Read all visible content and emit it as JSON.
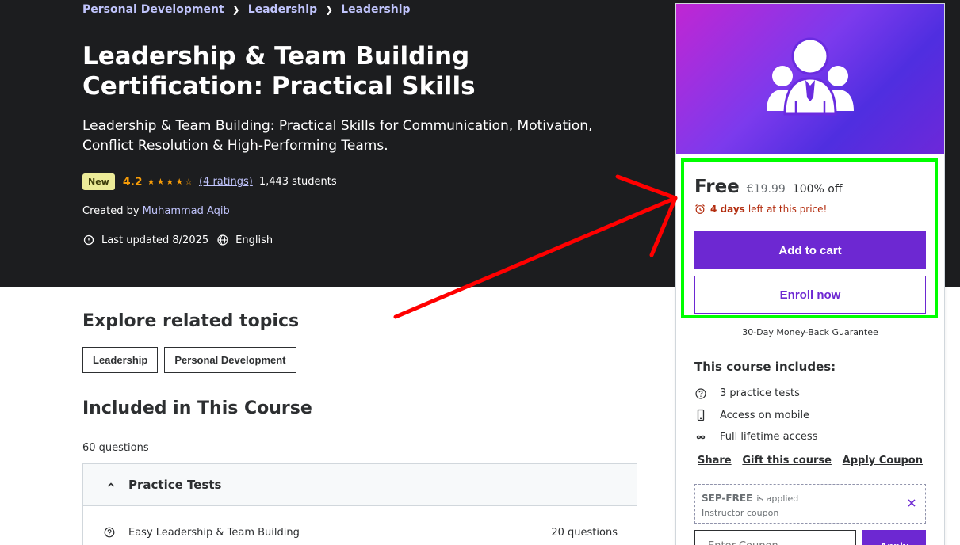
{
  "breadcrumb": [
    "Personal Development",
    "Leadership",
    "Leadership"
  ],
  "course": {
    "title": "Leadership & Team Building Certification: Practical Skills",
    "subtitle": "Leadership & Team Building: Practical Skills for Communication, Motivation, Conflict Resolution & High-Performing Teams.",
    "badge": "New",
    "rating": "4.2",
    "rating_value": 4.2,
    "ratings_link": "(4 ratings)",
    "students": "1,443 students",
    "created_by_label": "Created by",
    "instructor": "Muhammad Aqib",
    "last_updated": "Last updated 8/2025",
    "language": "English"
  },
  "related": {
    "heading": "Explore related topics",
    "topics": [
      "Leadership",
      "Personal Development"
    ]
  },
  "included": {
    "heading": "Included in This Course",
    "count": "60 questions",
    "section": "Practice Tests",
    "items": [
      {
        "name": "Easy Leadership & Team Building",
        "count": "20 questions"
      }
    ]
  },
  "sidebar": {
    "price": "Free",
    "original_price": "€19.99",
    "discount": "100% off",
    "timer_bold": "4 days",
    "timer_rest": "left at this price!",
    "add_to_cart": "Add to cart",
    "enroll_now": "Enroll now",
    "guarantee": "30-Day Money-Back Guarantee",
    "includes_title": "This course includes:",
    "includes": [
      {
        "icon": "question-circle-icon",
        "label": "3 practice tests"
      },
      {
        "icon": "mobile-icon",
        "label": "Access on mobile"
      },
      {
        "icon": "infinity-icon",
        "label": "Full lifetime access"
      }
    ],
    "links": [
      "Share",
      "Gift this course",
      "Apply Coupon"
    ],
    "coupon_code": "SEP-FREE",
    "coupon_applied": "is applied",
    "coupon_sub": "Instructor coupon",
    "coupon_placeholder": "Enter Coupon",
    "apply": "Apply"
  },
  "colors": {
    "hero_bg": "#1c1d1f",
    "accent_purple": "#6d28d2",
    "star": "#f69c08",
    "highlight_green": "#00ff00",
    "arrow_red": "#ff0000"
  }
}
